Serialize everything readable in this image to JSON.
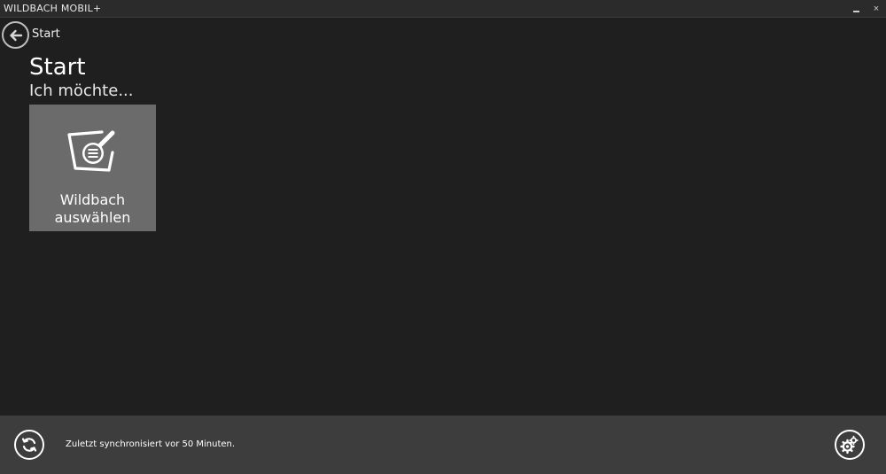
{
  "window": {
    "title": "WILDBACH MOBIL+",
    "minimize_icon": "minimize-icon",
    "close_symbol": "×"
  },
  "nav": {
    "back_icon": "arrow-left-icon",
    "breadcrumb": "Start"
  },
  "page": {
    "title": "Start",
    "subtitle": "Ich möchte..."
  },
  "tiles": [
    {
      "icon": "basket-search-icon",
      "label_line1": "Wildbach",
      "label_line2": "auswählen"
    }
  ],
  "bottombar": {
    "sync_icon": "sync-icon",
    "sync_status": "Zuletzt synchronisiert vor 50 Minuten.",
    "settings_icon": "gears-icon"
  },
  "colors": {
    "background": "#1f1f1f",
    "titlebar": "#2b2b2b",
    "tile": "#6b6b6b",
    "bottombar": "#3d3d3d"
  }
}
